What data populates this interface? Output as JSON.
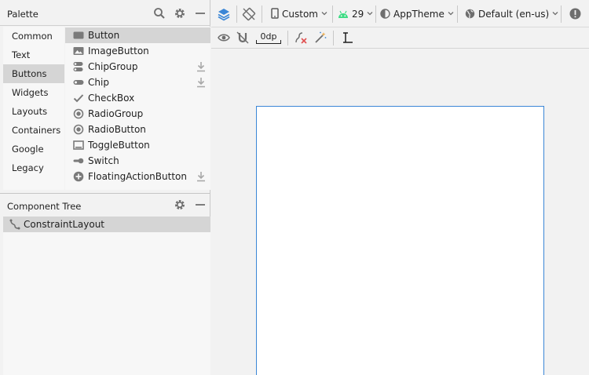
{
  "palette": {
    "title": "Palette",
    "icons": [
      "search-icon",
      "gear-icon",
      "minimize-icon"
    ],
    "categories": [
      {
        "label": "Common",
        "selected": false
      },
      {
        "label": "Text",
        "selected": false
      },
      {
        "label": "Buttons",
        "selected": true
      },
      {
        "label": "Widgets",
        "selected": false
      },
      {
        "label": "Layouts",
        "selected": false
      },
      {
        "label": "Containers",
        "selected": false
      },
      {
        "label": "Google",
        "selected": false
      },
      {
        "label": "Legacy",
        "selected": false
      }
    ],
    "components": [
      {
        "label": "Button",
        "icon": "button-icon",
        "selected": true,
        "download": false
      },
      {
        "label": "ImageButton",
        "icon": "image-button-icon",
        "selected": false,
        "download": false
      },
      {
        "label": "ChipGroup",
        "icon": "chip-group-icon",
        "selected": false,
        "download": true
      },
      {
        "label": "Chip",
        "icon": "chip-icon",
        "selected": false,
        "download": true
      },
      {
        "label": "CheckBox",
        "icon": "checkbox-icon",
        "selected": false,
        "download": false
      },
      {
        "label": "RadioGroup",
        "icon": "radio-group-icon",
        "selected": false,
        "download": false
      },
      {
        "label": "RadioButton",
        "icon": "radio-button-icon",
        "selected": false,
        "download": false
      },
      {
        "label": "ToggleButton",
        "icon": "toggle-button-icon",
        "selected": false,
        "download": false
      },
      {
        "label": "Switch",
        "icon": "switch-icon",
        "selected": false,
        "download": false
      },
      {
        "label": "FloatingActionButton",
        "icon": "fab-icon",
        "selected": false,
        "download": true
      }
    ]
  },
  "component_tree": {
    "title": "Component Tree",
    "icons": [
      "gear-icon",
      "minimize-icon"
    ],
    "items": [
      {
        "label": "ConstraintLayout",
        "icon": "constraint-layout-icon",
        "selected": true
      }
    ]
  },
  "toolbar": {
    "device": "Custom",
    "api_level": "29",
    "theme": "AppTheme",
    "locale": "Default (en-us)",
    "icons": [
      "layers-icon",
      "orientation-icon",
      "phone-icon",
      "android-icon",
      "theme-icon",
      "globe-icon",
      "warning-icon",
      "chevron-down-icon"
    ]
  },
  "toolbar2": {
    "default_margin": "0dp",
    "icons": [
      "eye-icon",
      "magnet-icon",
      "clear-constraints-icon",
      "magic-wand-icon",
      "guidelines-icon"
    ]
  },
  "colors": {
    "accent": "#3b86d6",
    "android_green": "#3ddc84",
    "selection": "#d5d5d5",
    "icon": "#6e6e6e",
    "error_red": "#e05050"
  }
}
